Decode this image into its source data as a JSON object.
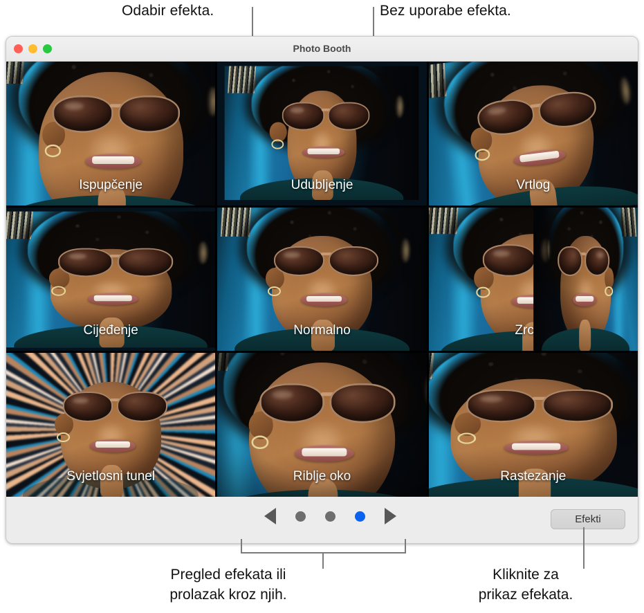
{
  "annotations": {
    "top_left": "Odabir efekta.",
    "top_right": "Bez uporabe efekta.",
    "bottom_left_line1": "Pregled efekata ili",
    "bottom_left_line2": "prolazak kroz njih.",
    "bottom_right_line1": "Kliknite za",
    "bottom_right_line2": "prikaz efekata."
  },
  "window": {
    "title": "Photo Booth",
    "traffic_lights": [
      {
        "name": "close",
        "color": "#ff5f57"
      },
      {
        "name": "minimize",
        "color": "#febc2e"
      },
      {
        "name": "zoom",
        "color": "#28c840"
      }
    ]
  },
  "grid": {
    "cells": [
      {
        "label": "Ispupčenje",
        "effect": "bulge",
        "selected": false
      },
      {
        "label": "Udubljenje",
        "effect": "pinch",
        "selected": false
      },
      {
        "label": "Vrtlog",
        "effect": "twirl",
        "selected": false
      },
      {
        "label": "Cijeđenje",
        "effect": "squeeze",
        "selected": false
      },
      {
        "label": "Normalno",
        "effect": "normal",
        "selected": true
      },
      {
        "label": "Zrcalo",
        "effect": "mirror",
        "selected": false
      },
      {
        "label": "Svjetlosni tunel",
        "effect": "tunnel",
        "selected": false
      },
      {
        "label": "Riblje oko",
        "effect": "fisheye",
        "selected": false
      },
      {
        "label": "Rastezanje",
        "effect": "stretch",
        "selected": false
      }
    ]
  },
  "toolbar": {
    "prev_icon": "triangle-left-icon",
    "next_icon": "triangle-right-icon",
    "page_dots": [
      {
        "active": false
      },
      {
        "active": false
      },
      {
        "active": true
      }
    ],
    "effects_button": "Efekti",
    "active_accent": "#0a62ef"
  }
}
